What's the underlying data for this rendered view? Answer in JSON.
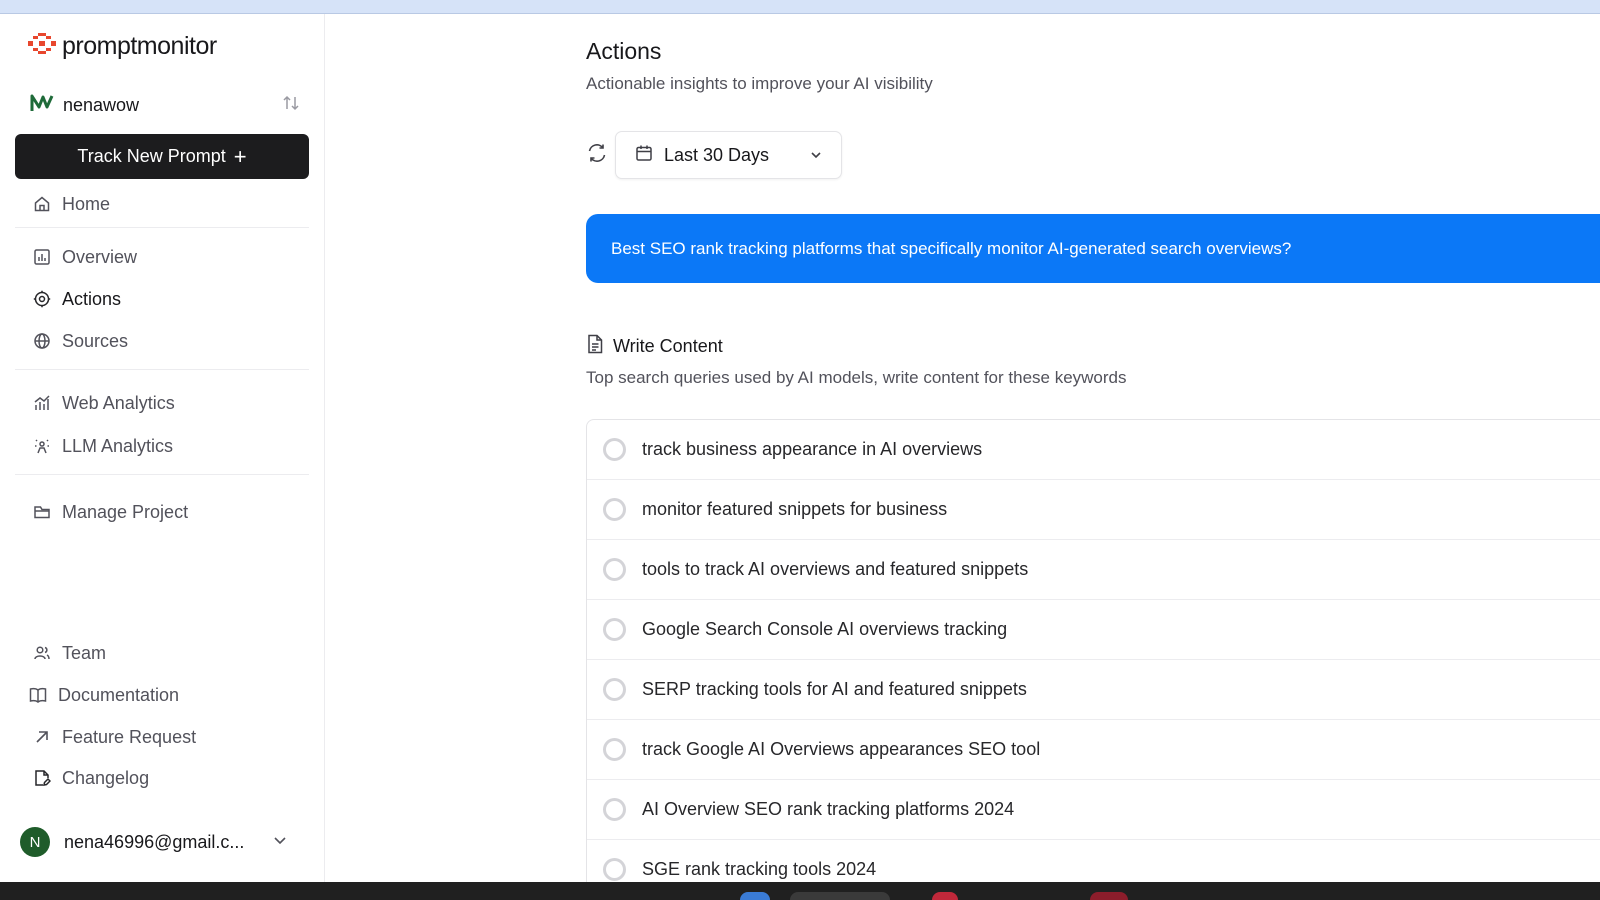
{
  "app": {
    "brand": "promptmonitor",
    "brand_color": "#e8472e"
  },
  "project": {
    "name": "nenawow"
  },
  "sidebar": {
    "track_button": "Track New Prompt",
    "items": [
      {
        "label": "Home",
        "icon": "home-icon"
      },
      {
        "label": "Overview",
        "icon": "bar-chart-icon"
      },
      {
        "label": "Actions",
        "icon": "actions-icon",
        "active": true
      },
      {
        "label": "Sources",
        "icon": "globe-icon"
      },
      {
        "label": "Web Analytics",
        "icon": "analytics-icon"
      },
      {
        "label": "LLM Analytics",
        "icon": "sparkle-person-icon"
      },
      {
        "label": "Manage Project",
        "icon": "folder-icon"
      },
      {
        "label": "Team",
        "icon": "users-icon"
      },
      {
        "label": "Documentation",
        "icon": "book-icon"
      },
      {
        "label": "Feature Request",
        "icon": "arrow-up-right-icon"
      },
      {
        "label": "Changelog",
        "icon": "file-edit-icon"
      }
    ]
  },
  "user": {
    "initial": "N",
    "email": "nena46996@gmail.c..."
  },
  "main": {
    "title": "Actions",
    "subtitle": "Actionable insights to improve your AI visibility",
    "date_range": "Last 30 Days",
    "prompt": "Best SEO rank tracking platforms that specifically monitor AI-generated search overviews?",
    "accent_color": "#0b78f7",
    "section": {
      "title": "Write Content",
      "description": "Top search queries used by AI models, write content for these keywords"
    },
    "queries": [
      "track business appearance in AI overviews",
      "monitor featured snippets for business",
      "tools to track AI overviews and featured snippets",
      "Google Search Console AI overviews tracking",
      "SERP tracking tools for AI and featured snippets",
      "track Google AI Overviews appearances SEO tool",
      "AI Overview SEO rank tracking platforms 2024",
      "SGE rank tracking tools 2024"
    ]
  }
}
